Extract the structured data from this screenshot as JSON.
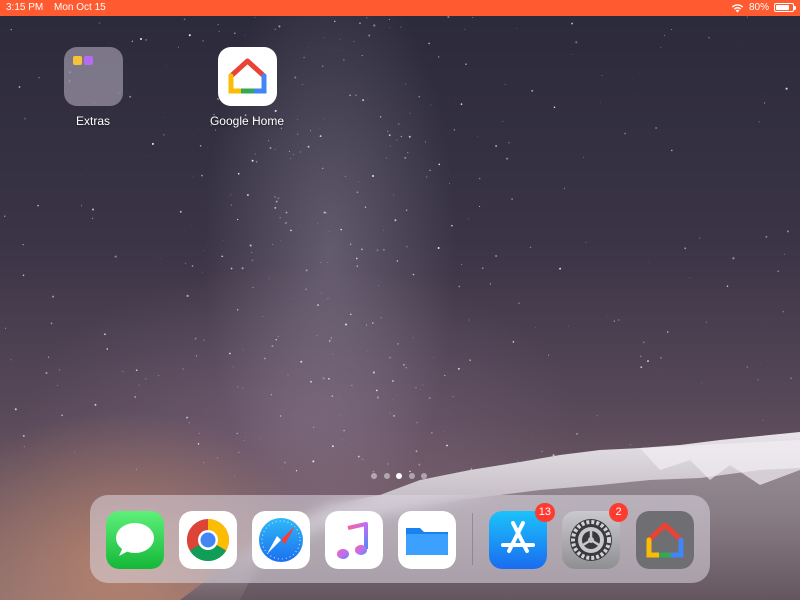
{
  "status_bar": {
    "time": "3:15 PM",
    "date": "Mon Oct 15",
    "battery": "80%",
    "battery_level": 0.8
  },
  "home_apps": [
    {
      "label": "Extras"
    },
    {
      "label": "Google Home"
    }
  ],
  "page_dots": {
    "count": 5,
    "active_index": 2
  },
  "dock": {
    "apps": [
      {
        "name": "Messages"
      },
      {
        "name": "Chrome"
      },
      {
        "name": "Safari"
      },
      {
        "name": "Music"
      },
      {
        "name": "Files"
      },
      {
        "name": "App Store",
        "badge": "13"
      },
      {
        "name": "Settings",
        "badge": "2"
      },
      {
        "name": "Google Home"
      }
    ]
  },
  "colors": {
    "status_bar": "#ff5a30",
    "badge": "#ff3b30"
  }
}
